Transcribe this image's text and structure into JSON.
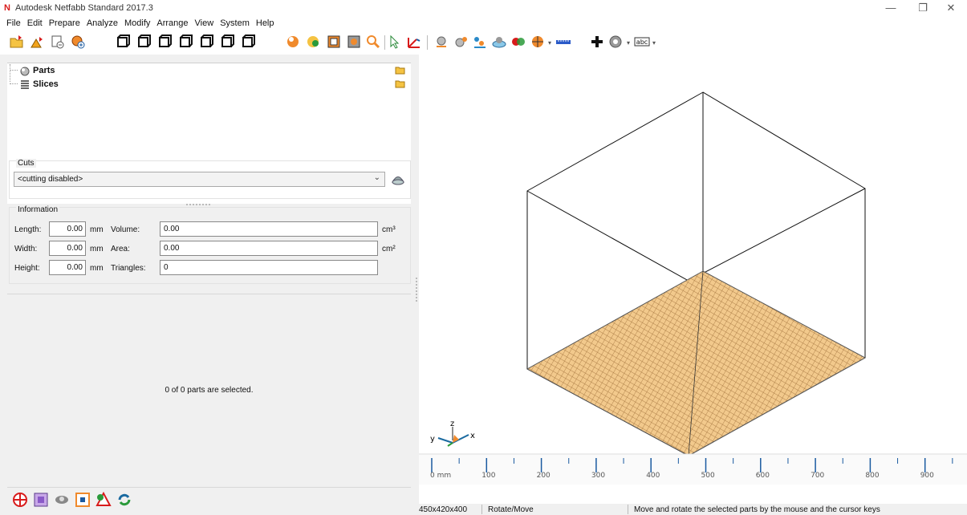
{
  "window": {
    "logo_letter": "N",
    "title": "Autodesk Netfabb Standard 2017.3",
    "minimize": "—",
    "maximize": "❐",
    "close": "✕"
  },
  "menu": [
    "File",
    "Edit",
    "Prepare",
    "Analyze",
    "Modify",
    "Arrange",
    "View",
    "System",
    "Help"
  ],
  "tree": {
    "items": [
      {
        "label": "Parts",
        "icon": "parts-icon"
      },
      {
        "label": "Slices",
        "icon": "slices-icon"
      }
    ]
  },
  "cuts": {
    "group_title": "Cuts",
    "selected": "<cutting disabled>",
    "chevron": "⌄"
  },
  "information": {
    "group_title": "Information",
    "length_label": "Length:",
    "length_value": "0.00",
    "width_label": "Width:",
    "width_value": "0.00",
    "height_label": "Height:",
    "height_value": "0.00",
    "unit_mm": "mm",
    "volume_label": "Volume:",
    "volume_value": "0.00",
    "volume_unit": "cm³",
    "area_label": "Area:",
    "area_value": "0.00",
    "area_unit": "cm²",
    "triangles_label": "Triangles:",
    "triangles_value": "0"
  },
  "selection_message": "0 of 0 parts are selected.",
  "viewport": {
    "axis_x": "x",
    "axis_y": "y",
    "axis_z": "z",
    "ruler_labels": [
      "0 mm",
      "100",
      "200",
      "300",
      "400",
      "500",
      "600",
      "700",
      "800",
      "900"
    ]
  },
  "status": {
    "platform": "450x420x400",
    "mode": "Rotate/Move",
    "hint": "Move and rotate the selected parts by the mouse and the cursor keys"
  },
  "colors": {
    "platform_fill": "#f2c98c",
    "platform_grid": "#9a6a34",
    "accent_red": "#d81b1b"
  }
}
